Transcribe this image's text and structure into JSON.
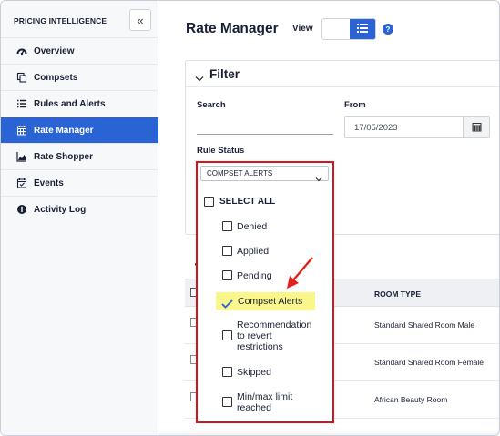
{
  "sidebar": {
    "title": "PRICING INTELLIGENCE",
    "collapse_glyph": "«",
    "items": [
      {
        "label": "Overview",
        "icon": "dashboard-icon",
        "active": false
      },
      {
        "label": "Compsets",
        "icon": "copy-icon",
        "active": false
      },
      {
        "label": "Rules and Alerts",
        "icon": "list-icon",
        "active": false
      },
      {
        "label": "Rate Manager",
        "icon": "calendar-grid-icon",
        "active": true
      },
      {
        "label": "Rate Shopper",
        "icon": "area-chart-icon",
        "active": false
      },
      {
        "label": "Events",
        "icon": "calendar-check-icon",
        "active": false
      },
      {
        "label": "Activity Log",
        "icon": "info-icon",
        "active": false
      }
    ]
  },
  "header": {
    "title": "Rate Manager",
    "view_label": "View",
    "help_glyph": "?"
  },
  "filter": {
    "title": "Filter",
    "search_label": "Search",
    "search_value": "",
    "from_label": "From",
    "from_value": "17/05/2023",
    "rule_status_label": "Rule Status",
    "rule_status_selected": "COMPSET ALERTS",
    "select_all_label": "SELECT ALL",
    "options": [
      {
        "label": "Denied",
        "checked": false
      },
      {
        "label": "Applied",
        "checked": false
      },
      {
        "label": "Pending",
        "checked": false
      },
      {
        "label": "Compset Alerts",
        "checked": true
      },
      {
        "label": "Recommendation to revert restrictions",
        "lines": [
          "Recommendation",
          "to revert",
          "restrictions"
        ],
        "checked": false
      },
      {
        "label": "Skipped",
        "checked": false
      },
      {
        "label": "Min/max limit reached",
        "lines": [
          "Min/max limit",
          "reached"
        ],
        "checked": false
      }
    ]
  },
  "table": {
    "room_type_header": "ROOM TYPE",
    "rows": [
      {
        "room_type": "Standard Shared Room Male"
      },
      {
        "room_type": "Standard Shared Room Female"
      },
      {
        "room_type": "African Beauty Room"
      }
    ]
  },
  "colors": {
    "accent": "#2a63d4",
    "highlight_border": "#d9121b",
    "highlight_fill": "#fbf68a",
    "annotation_arrow": "#e3201b"
  }
}
